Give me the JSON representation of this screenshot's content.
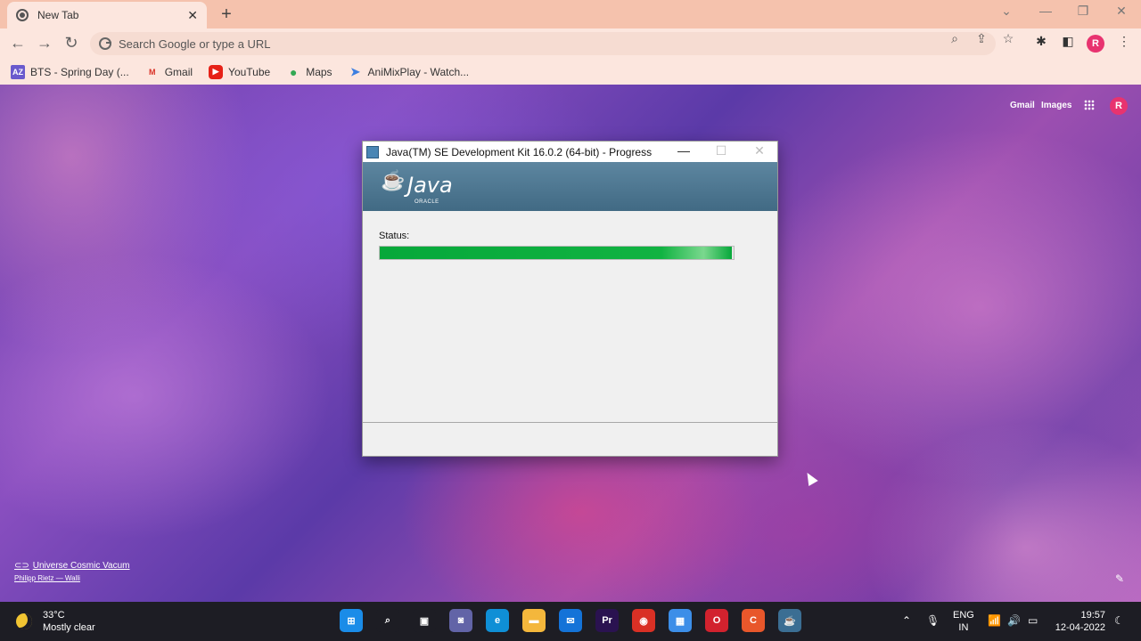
{
  "browser": {
    "tab_title": "New Tab",
    "tab_close": "✕",
    "new_tab": "+",
    "omnibox_placeholder": "Search Google or type a URL",
    "profile_initial": "R",
    "bookmarks": [
      {
        "label": "BTS - Spring Day (...",
        "icon": "az-icon",
        "color": "#6a5acd",
        "glyph": "AZ"
      },
      {
        "label": "Gmail",
        "icon": "gmail-icon",
        "color": "#ffffff",
        "glyph": "M"
      },
      {
        "label": "YouTube",
        "icon": "youtube-icon",
        "color": "#e62117",
        "glyph": "▶"
      },
      {
        "label": "Maps",
        "icon": "maps-icon",
        "color": "#34a853",
        "glyph": "●"
      },
      {
        "label": "AniMixPlay - Watch...",
        "icon": "animixplay-icon",
        "color": "#3d7fe0",
        "glyph": "➤"
      }
    ]
  },
  "newtab_page": {
    "gmail_link": "Gmail",
    "images_link": "Images",
    "profile_initial": "R",
    "background_title": "Universe Cosmic Vacum",
    "background_credit": "Philipp Rietz — Walli"
  },
  "dialog": {
    "title": "Java(TM) SE Development Kit 16.0.2 (64-bit) - Progress",
    "brand": "Java",
    "brand_sub": "ORACLE",
    "status_label": "Status:",
    "progress_fraction": 0.995,
    "minimize": "—",
    "maximize": "☐",
    "close": "✕"
  },
  "taskbar": {
    "temperature": "33°C",
    "weather": "Mostly clear",
    "language_top": "ENG",
    "language_bottom": "IN",
    "time": "19:57",
    "date": "12-04-2022",
    "apps": [
      {
        "name": "start-button",
        "glyph": "⊞",
        "color": "#1a8ce8"
      },
      {
        "name": "search-button",
        "glyph": "⌕",
        "color": "#1d1d24"
      },
      {
        "name": "task-view-button",
        "glyph": "▣",
        "color": "#1d1d24"
      },
      {
        "name": "teams-chat-button",
        "glyph": "◙",
        "color": "#6264a7"
      },
      {
        "name": "edge-button",
        "glyph": "e",
        "color": "#0f8fd6"
      },
      {
        "name": "file-explorer-button",
        "glyph": "▬",
        "color": "#f4b73c"
      },
      {
        "name": "mail-button",
        "glyph": "✉",
        "color": "#1473d8"
      },
      {
        "name": "premiere-button",
        "glyph": "Pr",
        "color": "#2a1250"
      },
      {
        "name": "chrome-button",
        "glyph": "◉",
        "color": "#d93025"
      },
      {
        "name": "store-button",
        "glyph": "▦",
        "color": "#3c8ee8"
      },
      {
        "name": "opera-button",
        "glyph": "O",
        "color": "#d2222e"
      },
      {
        "name": "app-c-button",
        "glyph": "C",
        "color": "#e8572b"
      },
      {
        "name": "java-installer-button",
        "glyph": "☕",
        "color": "#3b6e93"
      }
    ]
  }
}
